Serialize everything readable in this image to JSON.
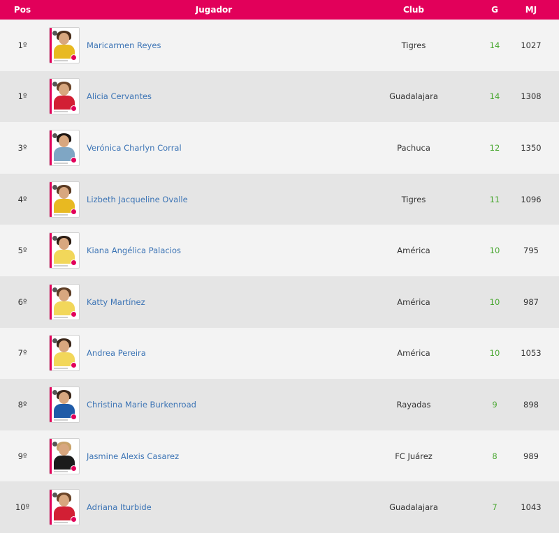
{
  "header": {
    "pos": "Pos",
    "player": "Jugador",
    "club": "Club",
    "goals": "G",
    "minutes": "MJ"
  },
  "colors": {
    "header_bg": "#e2005a",
    "link": "#3c74b5",
    "goals": "#4aa832",
    "row_odd": "#f3f3f3",
    "row_even": "#e5e5e5"
  },
  "rows": [
    {
      "pos": "1º",
      "name": "Maricarmen Reyes",
      "club": "Tigres",
      "g": "14",
      "mj": "1027",
      "jersey": "#e8b921",
      "hair": "#4a2e1a"
    },
    {
      "pos": "1º",
      "name": "Alicia Cervantes",
      "club": "Guadalajara",
      "g": "14",
      "mj": "1308",
      "jersey": "#d21f34",
      "hair": "#6b4428"
    },
    {
      "pos": "3º",
      "name": "Verónica Charlyn Corral",
      "club": "Pachuca",
      "g": "12",
      "mj": "1350",
      "jersey": "#7fa6c4",
      "hair": "#1e1612"
    },
    {
      "pos": "4º",
      "name": "Lizbeth Jacqueline Ovalle",
      "club": "Tigres",
      "g": "11",
      "mj": "1096",
      "jersey": "#e8b921",
      "hair": "#5a3a22"
    },
    {
      "pos": "5º",
      "name": "Kiana Angélica Palacios",
      "club": "América",
      "g": "10",
      "mj": "795",
      "jersey": "#f2d75a",
      "hair": "#2b1c12"
    },
    {
      "pos": "6º",
      "name": "Katty Martínez",
      "club": "América",
      "g": "10",
      "mj": "987",
      "jersey": "#f2d75a",
      "hair": "#5c3c24"
    },
    {
      "pos": "7º",
      "name": "Andrea Pereira",
      "club": "América",
      "g": "10",
      "mj": "1053",
      "jersey": "#f2d75a",
      "hair": "#3a2618"
    },
    {
      "pos": "8º",
      "name": "Christina Marie Burkenroad",
      "club": "Rayadas",
      "g": "9",
      "mj": "898",
      "jersey": "#1f5ba8",
      "hair": "#3a2618"
    },
    {
      "pos": "9º",
      "name": "Jasmine Alexis Casarez",
      "club": "FC Juárez",
      "g": "8",
      "mj": "989",
      "jersey": "#1c1c1c",
      "hair": "#c9a26a"
    },
    {
      "pos": "10º",
      "name": "Adriana Iturbide",
      "club": "Guadalajara",
      "g": "7",
      "mj": "1043",
      "jersey": "#d21f34",
      "hair": "#6b4428"
    }
  ]
}
